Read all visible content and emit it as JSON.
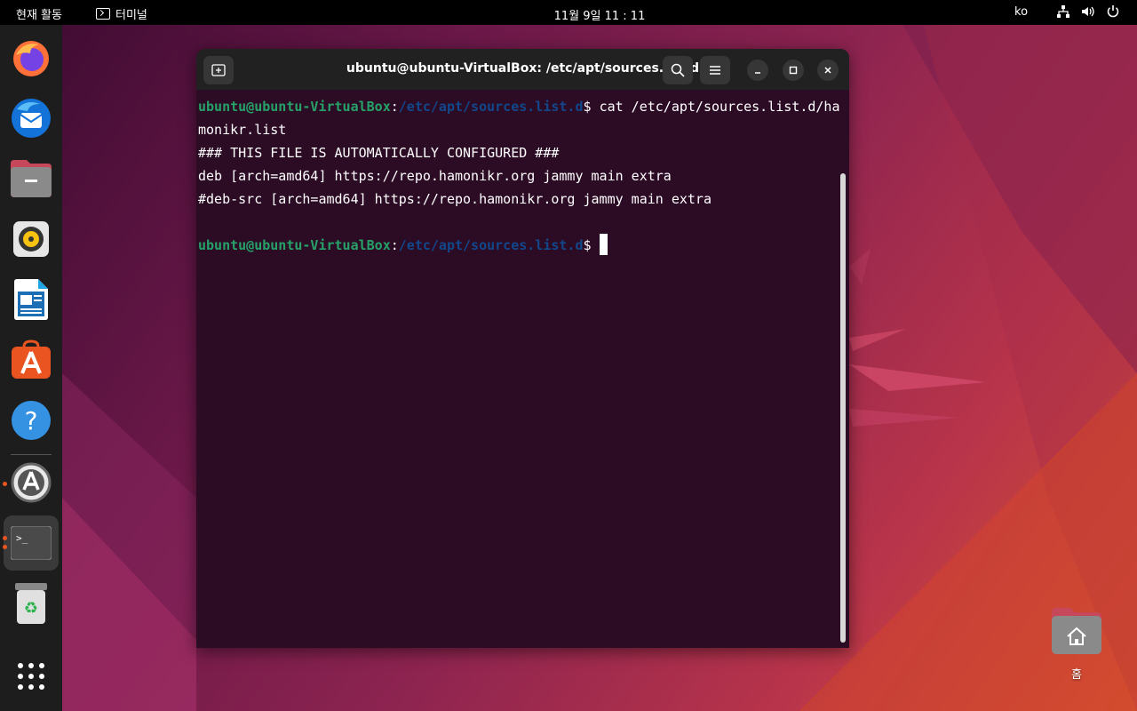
{
  "topbar": {
    "activities": "현재 활동",
    "app_name": "터미널",
    "clock": "11월 9일  11 : 11",
    "language": "ko"
  },
  "dock": {
    "apps": [
      "firefox-icon",
      "thunderbird-icon",
      "files-icon",
      "rhythmbox-icon",
      "libreoffice-writer-icon",
      "app-center-icon",
      "help-icon",
      "software-updater-icon",
      "terminal-icon",
      "trash-icon",
      "show-apps-icon"
    ]
  },
  "terminal": {
    "title": "ubuntu@ubuntu-VirtualBox: /etc/apt/sources.list.d",
    "lines": [
      {
        "user": "ubuntu@ubuntu-VirtualBox",
        "colon": ":",
        "path": "/etc/apt/sources.list.d",
        "dollar": "$ ",
        "cmd": "cat /etc/apt/sources.list.d/ha"
      },
      {
        "text": "monikr.list"
      },
      {
        "text": "### THIS FILE IS AUTOMATICALLY CONFIGURED ###"
      },
      {
        "text": "deb [arch=amd64] https://repo.hamonikr.org jammy main extra"
      },
      {
        "text": "#deb-src [arch=amd64] https://repo.hamonikr.org jammy main extra"
      },
      {
        "text": ""
      },
      {
        "user": "ubuntu@ubuntu-VirtualBox",
        "colon": ":",
        "path": "/etc/apt/sources.list.d",
        "dollar": "$ ",
        "cmd": ""
      }
    ]
  },
  "desktop": {
    "home_label": "홈"
  },
  "colors": {
    "prompt_user": "#26a269",
    "prompt_path": "#12488b",
    "terminal_bg": "#2c0b24",
    "accent": "#e95420"
  }
}
